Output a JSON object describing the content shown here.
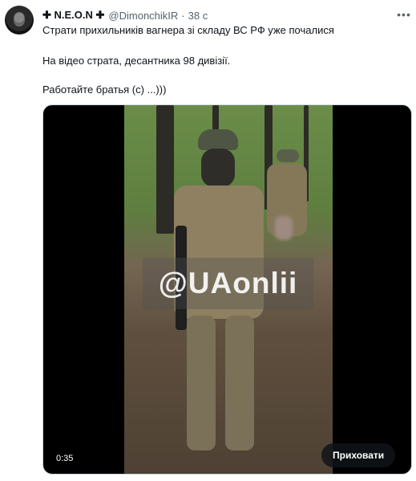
{
  "tweet": {
    "author_name": "✚ N.E.O.N ✚",
    "handle": "@DimonchikIR",
    "separator": "·",
    "time": "38 с",
    "more_icon": "more-icon",
    "text_lines": [
      "Страти прихильників вагнера зі складу ВС РФ уже почалися",
      "На відео страта, десантника 98 дивізії.",
      "Работайте братья (с) ...)))"
    ]
  },
  "media": {
    "watermark": "@UAonlii",
    "duration": "0:35",
    "hide_button_label": "Приховати"
  }
}
